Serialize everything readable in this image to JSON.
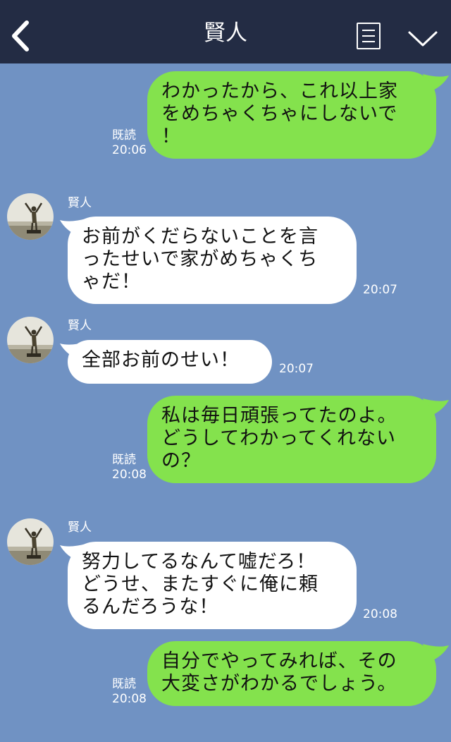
{
  "header": {
    "title": "賢人"
  },
  "contact_name": "賢人",
  "messages": [
    {
      "side": "me",
      "text": "わかったから、これ以上家\nをめちゃくちゃにしないで\n！",
      "read": "既読",
      "time": "20:06"
    },
    {
      "side": "them",
      "sender": "賢人",
      "text": "お前がくだらないことを言\nったせいで家がめちゃくち\nゃだ！",
      "time": "20:07"
    },
    {
      "side": "them",
      "sender": "賢人",
      "text": "全部お前のせい！",
      "time": "20:07"
    },
    {
      "side": "me",
      "text": "私は毎日頑張ってたのよ。\nどうしてわかってくれない\nの？",
      "read": "既読",
      "time": "20:08"
    },
    {
      "side": "them",
      "sender": "賢人",
      "text": "努力してるなんて嘘だろ！\nどうせ、またすぐに俺に頼\nるんだろうな！",
      "time": "20:08"
    },
    {
      "side": "me",
      "text": "自分でやってみれば、その\n大変さがわかるでしょう。",
      "read": "既読",
      "time": "20:08"
    }
  ],
  "colors": {
    "header": "#232c44",
    "background": "#7092c3",
    "my_bubble": "#84e24d",
    "their_bubble": "#ffffff"
  },
  "icons": {
    "back": "chevron-left-icon",
    "menu": "note-icon",
    "more": "chevron-down-icon"
  }
}
